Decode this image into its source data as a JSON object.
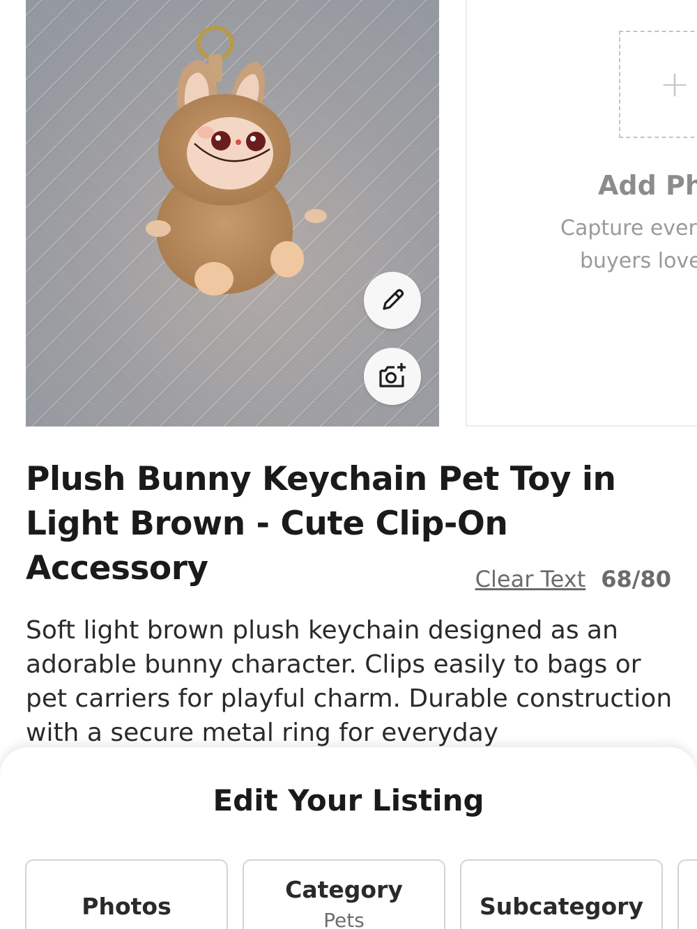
{
  "photos": {
    "main_photo_alt": "",
    "edit_icon": "pencil-icon",
    "add_photo_icon": "camera-plus-icon",
    "add_card": {
      "plus": "+",
      "title": "Add Pho",
      "subtitle_line1": "Capture every",
      "subtitle_line2": "buyers love"
    }
  },
  "listing": {
    "title": "Plush Bunny Keychain Pet Toy in Light Brown - Cute Clip-On Accessory",
    "clear_text_label": "Clear Text",
    "char_count": "68/80",
    "description": "Soft light brown plush keychain designed as an adorable bunny character. Clips easily to bags or pet carriers for playful charm. Durable construction with a secure metal ring for everyday"
  },
  "sheet": {
    "title": "Edit Your Listing",
    "tabs": [
      {
        "label": "Photos",
        "value": ""
      },
      {
        "label": "Category",
        "value": "Pets"
      },
      {
        "label": "Subcategory",
        "value": ""
      }
    ]
  },
  "colors": {
    "background": "#ffffff",
    "text_primary": "#1a1a1a",
    "text_muted": "#6b6b6b",
    "border": "#d4d4d4",
    "photo_background": "#9ea2a9"
  }
}
